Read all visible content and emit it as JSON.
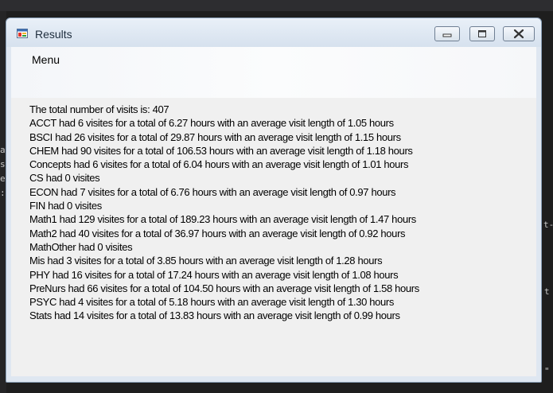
{
  "window": {
    "title": "Results",
    "menu": [
      {
        "label": "Menu"
      }
    ]
  },
  "results": {
    "lines": [
      "The total number of visits is: 407",
      "ACCT had 6 visites for a total of 6.27 hours with an average visit length of 1.05 hours",
      "BSCI had 26 visites for a total of 29.87 hours with an average visit length of 1.15 hours",
      "CHEM had 90 visites for a total of 106.53 hours with an average visit length of 1.18 hours",
      "Concepts had 6 visites for a total of 6.04 hours with an average visit length of 1.01 hours",
      "CS had 0 visites",
      "ECON had 7 visites for a total of 6.76 hours with an average visit length of 0.97 hours",
      "FIN had 0 visites",
      "Math1 had 129 visites for a total of 189.23 hours with an average visit length of 1.47 hours",
      "Math2 had 40 visites for a total of 36.97 hours with an average visit length of 0.92 hours",
      "MathOther had 0 visites",
      "Mis had 3 visites for a total of 3.85 hours with an average visit length of 1.28 hours",
      "PHY had 16 visites for a total of 17.24 hours with an average visit length of 1.08 hours",
      "PreNurs had 66 visites for a total of 104.50 hours with an average visit length of 1.58 hours",
      "PSYC had 4 visites for a total of 5.18 hours with an average visit length of 1.30 hours",
      "Stats had 14 visites for a total of 13.83 hours with an average visit length of 0.99 hours"
    ]
  },
  "background": {
    "left_glyphs": [
      "a",
      "s",
      "e",
      ":"
    ],
    "right_glyphs": [
      "t-",
      "t",
      "\""
    ]
  },
  "colors": {
    "window_frame": "#dfe7f1",
    "client_bg": "#f0f0f0",
    "ide_bg": "#1e1e1e"
  }
}
